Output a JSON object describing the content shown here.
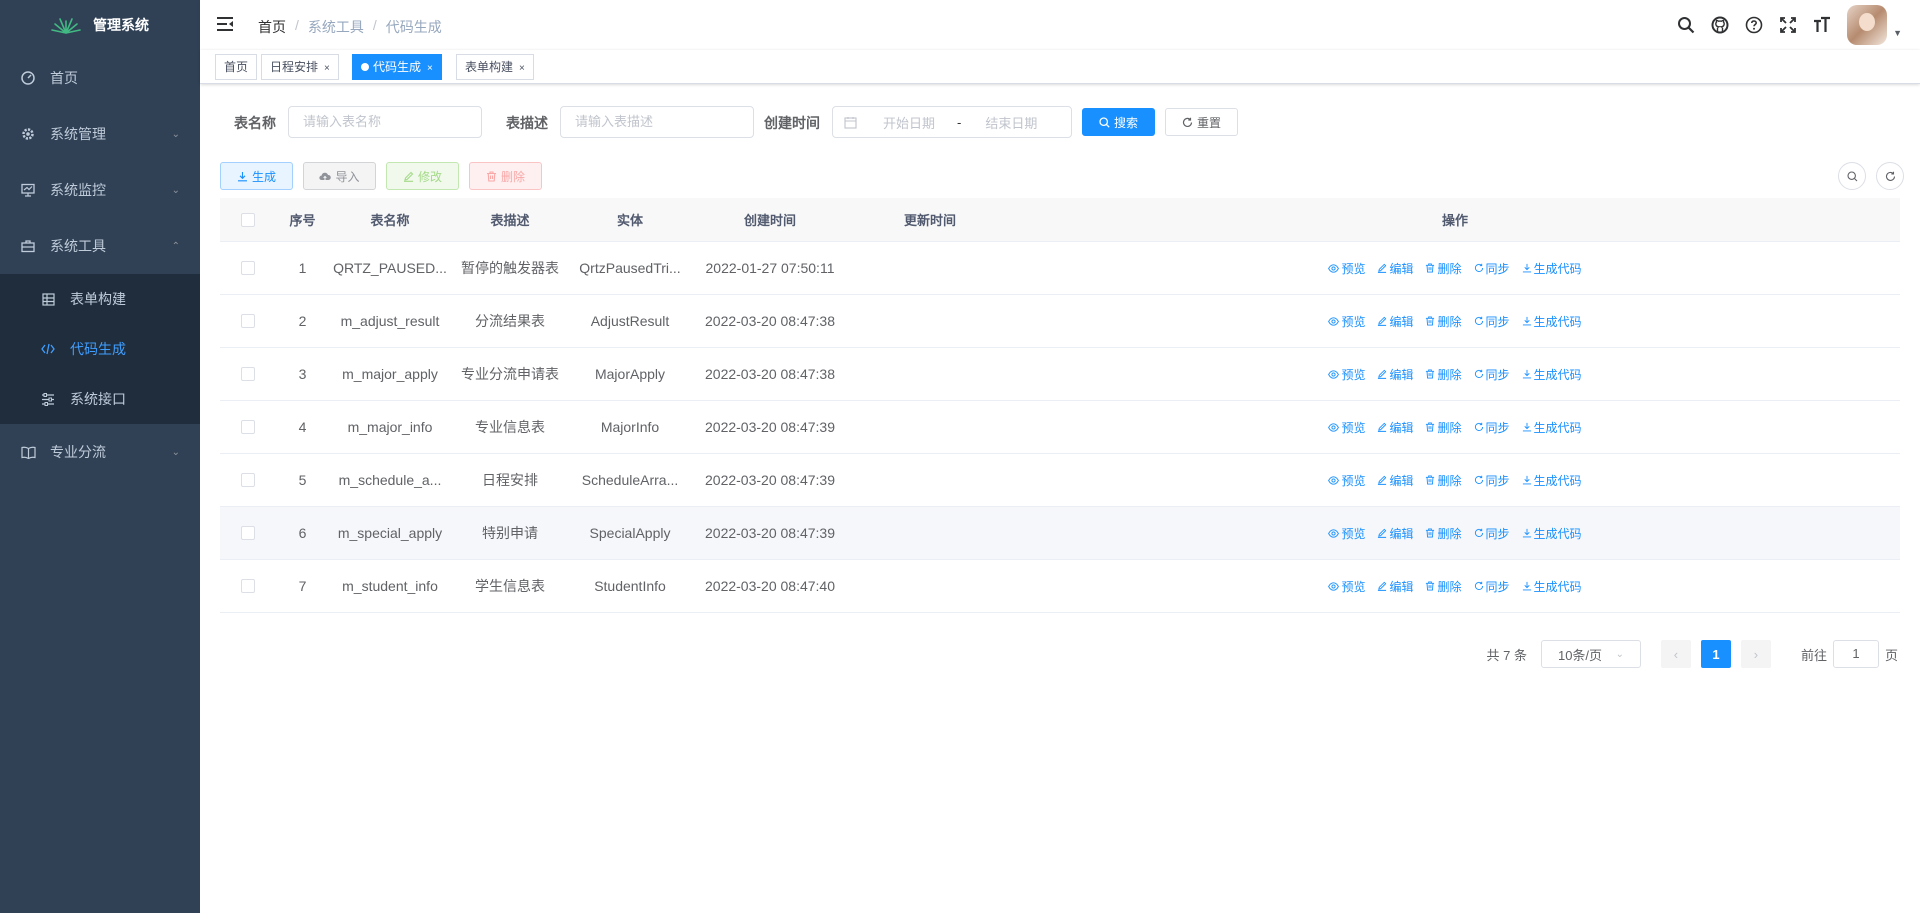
{
  "app": {
    "title": "管理系统"
  },
  "sidebar": {
    "items": [
      {
        "label": "首页",
        "icon": "dashboard-icon"
      },
      {
        "label": "系统管理",
        "icon": "gear-icon"
      },
      {
        "label": "系统监控",
        "icon": "monitor-icon"
      },
      {
        "label": "系统工具",
        "icon": "toolbox-icon"
      },
      {
        "label": "专业分流",
        "icon": "book-icon"
      }
    ],
    "sub_items": [
      {
        "label": "表单构建",
        "icon": "grid-icon"
      },
      {
        "label": "代码生成",
        "icon": "code-icon"
      },
      {
        "label": "系统接口",
        "icon": "sliders-icon"
      }
    ]
  },
  "breadcrumb": [
    "首页",
    "系统工具",
    "代码生成"
  ],
  "tags": [
    "首页",
    "日程安排",
    "代码生成",
    "表单构建"
  ],
  "search": {
    "table_name_label": "表名称",
    "table_name_placeholder": "请输入表名称",
    "table_desc_label": "表描述",
    "table_desc_placeholder": "请输入表描述",
    "created_label": "创建时间",
    "start_placeholder": "开始日期",
    "range_sep": "-",
    "end_placeholder": "结束日期",
    "search_button": "搜索",
    "reset_button": "重置"
  },
  "toolbar": {
    "generate": "生成",
    "import": "导入",
    "edit": "修改",
    "delete": "删除"
  },
  "table": {
    "headers": [
      "序号",
      "表名称",
      "表描述",
      "实体",
      "创建时间",
      "更新时间",
      "操作"
    ],
    "rows": [
      {
        "no": "1",
        "name": "QRTZ_PAUSED...",
        "desc": "暂停的触发器表",
        "entity": "QrtzPausedTri...",
        "created": "2022-01-27 07:50:11",
        "updated": ""
      },
      {
        "no": "2",
        "name": "m_adjust_result",
        "desc": "分流结果表",
        "entity": "AdjustResult",
        "created": "2022-03-20 08:47:38",
        "updated": ""
      },
      {
        "no": "3",
        "name": "m_major_apply",
        "desc": "专业分流申请表",
        "entity": "MajorApply",
        "created": "2022-03-20 08:47:38",
        "updated": ""
      },
      {
        "no": "4",
        "name": "m_major_info",
        "desc": "专业信息表",
        "entity": "MajorInfo",
        "created": "2022-03-20 08:47:39",
        "updated": ""
      },
      {
        "no": "5",
        "name": "m_schedule_a...",
        "desc": "日程安排",
        "entity": "ScheduleArra...",
        "created": "2022-03-20 08:47:39",
        "updated": ""
      },
      {
        "no": "6",
        "name": "m_special_apply",
        "desc": "特别申请",
        "entity": "SpecialApply",
        "created": "2022-03-20 08:47:39",
        "updated": ""
      },
      {
        "no": "7",
        "name": "m_student_info",
        "desc": "学生信息表",
        "entity": "StudentInfo",
        "created": "2022-03-20 08:47:40",
        "updated": ""
      }
    ],
    "row_actions": [
      "预览",
      "编辑",
      "删除",
      "同步",
      "生成代码"
    ]
  },
  "pagination": {
    "total": "共 7 条",
    "page_size": "10条/页",
    "current": "1",
    "goto_label": "前往",
    "goto_value": "1",
    "page_suffix": "页"
  },
  "colors": {
    "sidebar_bg": "#304156",
    "submenu_bg": "#1f2d3d",
    "primary": "#1890ff"
  }
}
